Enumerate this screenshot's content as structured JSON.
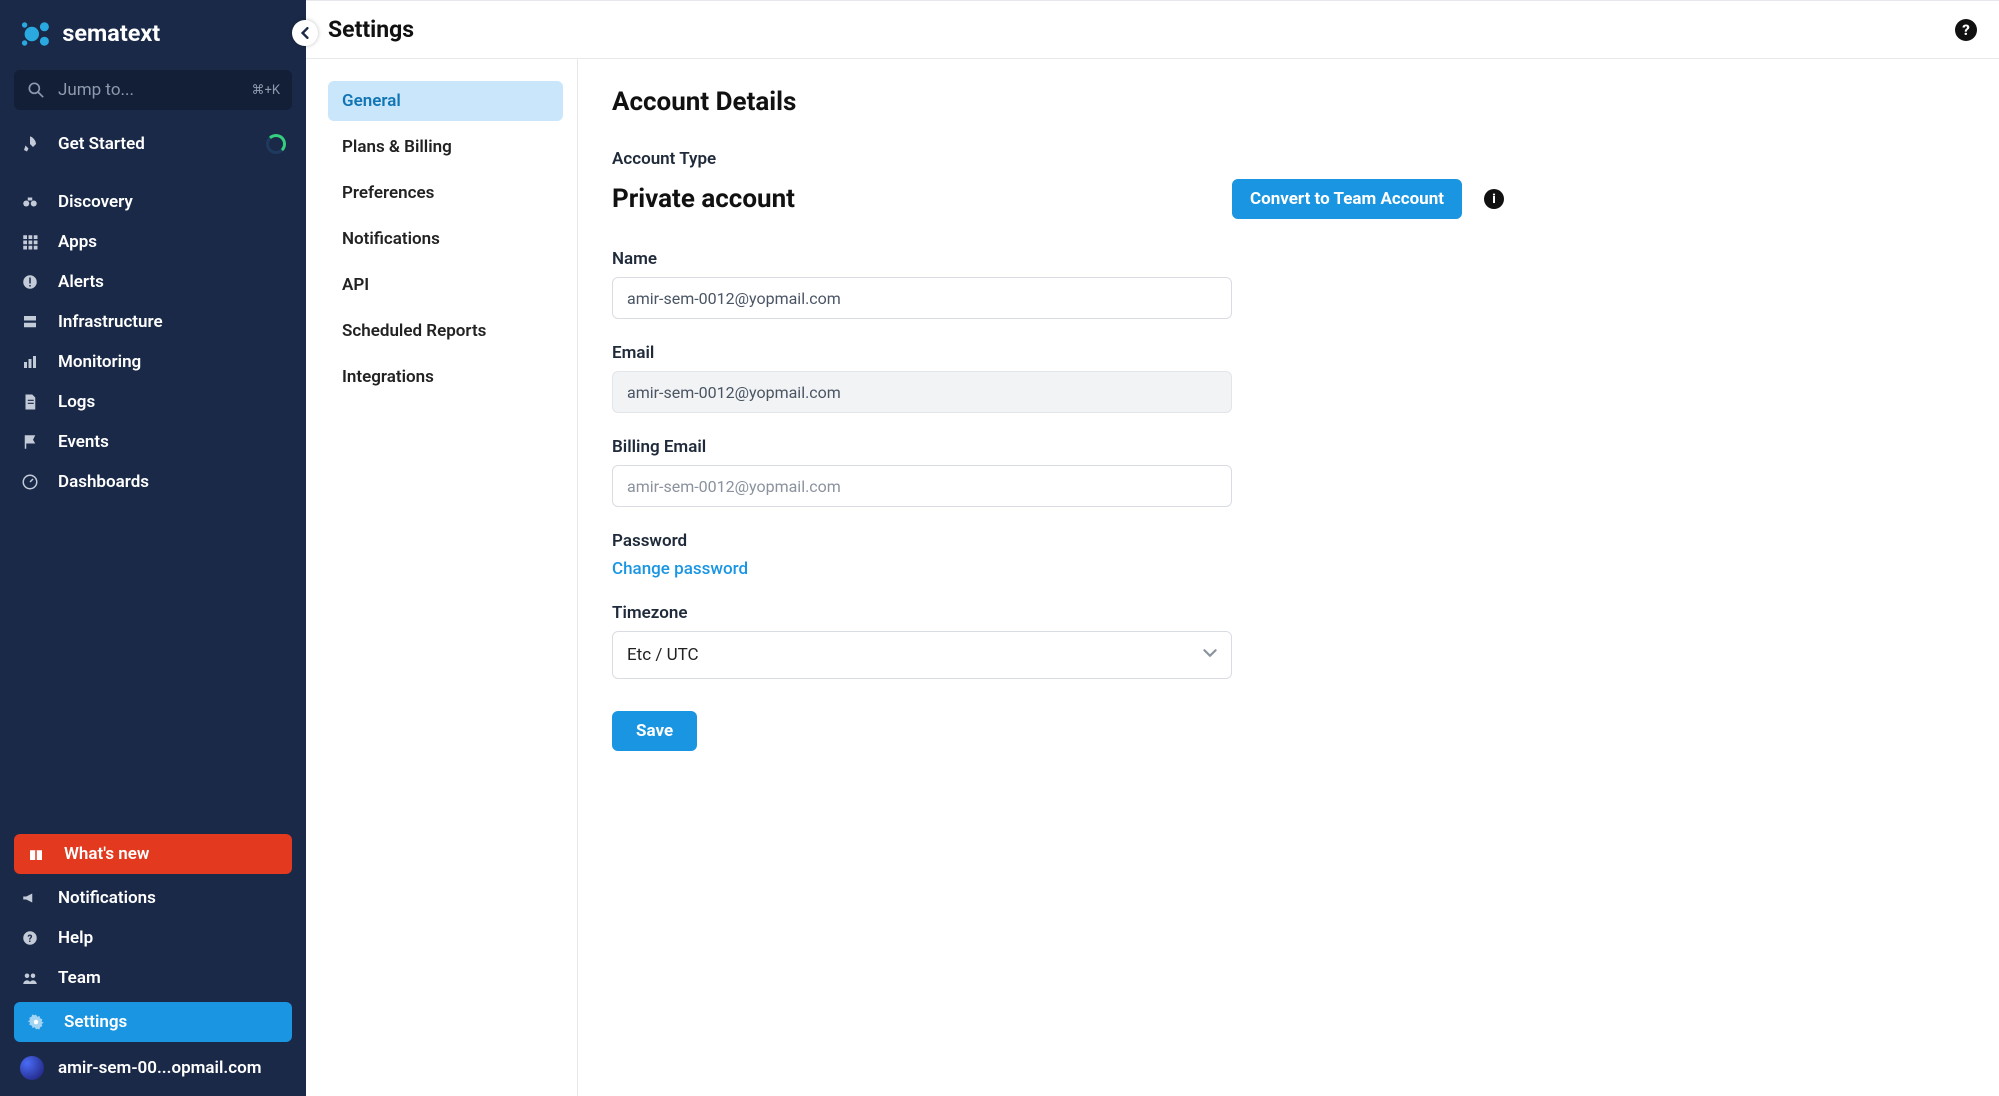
{
  "brand": "sematext",
  "jump": {
    "placeholder": "Jump to...",
    "shortcut": "⌘+K"
  },
  "sidebar": {
    "get_started": "Get Started",
    "items": [
      {
        "label": "Discovery"
      },
      {
        "label": "Apps"
      },
      {
        "label": "Alerts"
      },
      {
        "label": "Infrastructure"
      },
      {
        "label": "Monitoring"
      },
      {
        "label": "Logs"
      },
      {
        "label": "Events"
      },
      {
        "label": "Dashboards"
      }
    ],
    "whats_new": "What's new",
    "notifications": "Notifications",
    "help": "Help",
    "team": "Team",
    "settings": "Settings",
    "user": "amir-sem-00...opmail.com"
  },
  "page": {
    "title": "Settings",
    "subnav": [
      "General",
      "Plans & Billing",
      "Preferences",
      "Notifications",
      "API",
      "Scheduled Reports",
      "Integrations"
    ]
  },
  "account": {
    "heading": "Account Details",
    "type_label": "Account Type",
    "type_value": "Private account",
    "convert_button": "Convert to Team Account",
    "name_label": "Name",
    "name_value": "amir-sem-0012@yopmail.com",
    "email_label": "Email",
    "email_value": "amir-sem-0012@yopmail.com",
    "billing_label": "Billing Email",
    "billing_placeholder": "amir-sem-0012@yopmail.com",
    "password_label": "Password",
    "change_password": "Change password",
    "timezone_label": "Timezone",
    "timezone_value": "Etc / UTC",
    "save": "Save"
  }
}
